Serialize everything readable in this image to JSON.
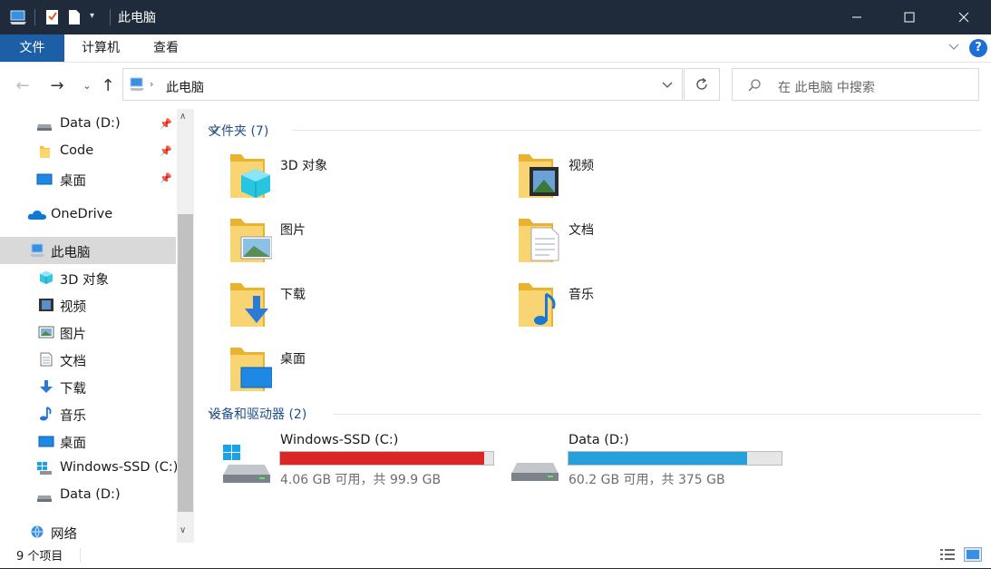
{
  "window": {
    "title": "此电脑"
  },
  "ribbon": {
    "tabs": [
      "文件",
      "计算机",
      "查看"
    ]
  },
  "address": {
    "path": "此电脑"
  },
  "search": {
    "placeholder": "在 此电脑 中搜索"
  },
  "sidebar": {
    "items": [
      {
        "label": "Data (D:)",
        "icon": "drive-icon"
      },
      {
        "label": "Code",
        "icon": "folder-icon"
      },
      {
        "label": "桌面",
        "icon": "desktop-icon"
      },
      {
        "label": "OneDrive",
        "icon": "onedrive-icon"
      },
      {
        "label": "此电脑",
        "icon": "this-pc-icon"
      },
      {
        "label": "3D 对象",
        "icon": "3d-objects-icon"
      },
      {
        "label": "视频",
        "icon": "videos-icon"
      },
      {
        "label": "图片",
        "icon": "pictures-icon"
      },
      {
        "label": "文档",
        "icon": "documents-icon"
      },
      {
        "label": "下载",
        "icon": "downloads-icon"
      },
      {
        "label": "音乐",
        "icon": "music-icon"
      },
      {
        "label": "桌面",
        "icon": "desktop-icon"
      },
      {
        "label": "Windows-SSD (C:)",
        "icon": "windows-drive-icon"
      },
      {
        "label": "Data (D:)",
        "icon": "drive-icon"
      },
      {
        "label": "网络",
        "icon": "network-icon"
      }
    ]
  },
  "content": {
    "folders_header": "文件夹 (7)",
    "folders": [
      {
        "label": "3D 对象",
        "icon": "3d-objects-folder-icon"
      },
      {
        "label": "视频",
        "icon": "videos-folder-icon"
      },
      {
        "label": "图片",
        "icon": "pictures-folder-icon"
      },
      {
        "label": "文档",
        "icon": "documents-folder-icon"
      },
      {
        "label": "下载",
        "icon": "downloads-folder-icon"
      },
      {
        "label": "音乐",
        "icon": "music-folder-icon"
      },
      {
        "label": "桌面",
        "icon": "desktop-folder-icon"
      }
    ],
    "drives_header": "设备和驱动器 (2)",
    "drives": [
      {
        "name": "Windows-SSD (C:)",
        "space": "4.06 GB 可用，共 99.9 GB",
        "used_fraction": 0.959,
        "bar_color": "#da2626"
      },
      {
        "name": "Data (D:)",
        "space": "60.2 GB 可用，共 375 GB",
        "used_fraction": 0.839,
        "bar_color": "#26a0da"
      }
    ]
  },
  "status": {
    "text": "9 个项目"
  },
  "colors": {
    "titlebar": "#1f2b3a",
    "file_tab": "#1c5fa6",
    "folder": "#f5c342",
    "header_text": "#1e4e8c"
  }
}
